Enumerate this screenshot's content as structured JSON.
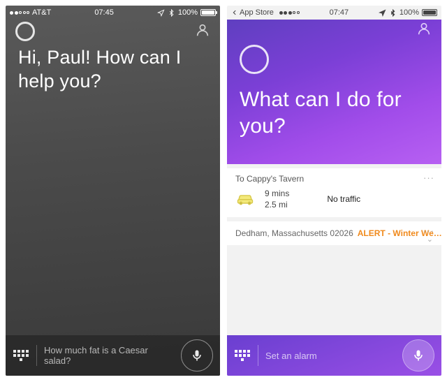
{
  "left": {
    "status": {
      "carrier": "AT&T",
      "time": "07:45",
      "battery": "100%"
    },
    "greeting": "Hi, Paul! How can I help you?",
    "bottom": {
      "placeholder": "How much fat is a Caesar salad?"
    }
  },
  "right": {
    "status": {
      "back_label": "App Store",
      "time": "07:47",
      "battery": "100%"
    },
    "greeting": "What can I do for you?",
    "card1": {
      "title": "To Cappy's Tavern",
      "duration": "9 mins",
      "distance": "2.5 mi",
      "traffic": "No traffic"
    },
    "card2": {
      "location": "Dedham, Massachusetts 02026",
      "alert": "ALERT - Winter We…"
    },
    "bottom": {
      "placeholder": "Set an alarm"
    }
  }
}
